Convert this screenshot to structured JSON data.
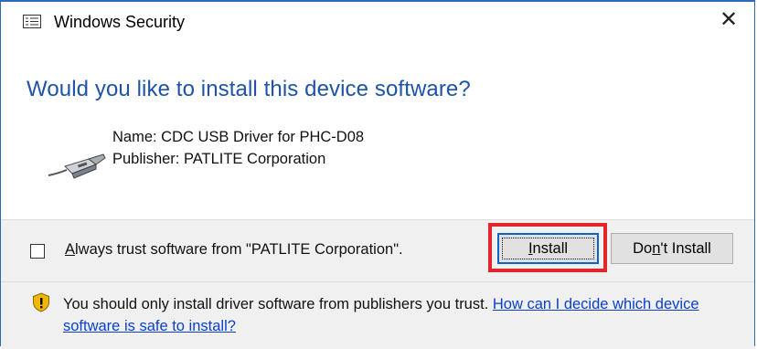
{
  "window": {
    "title": "Windows Security",
    "close_glyph": "✕"
  },
  "main": {
    "question": "Would you like to install this device software?",
    "device_name": "Name: CDC USB Driver for PHC-D08",
    "publisher": "Publisher: PATLITE Corporation"
  },
  "footer": {
    "trust_checkbox_checked": false,
    "trust_label_accel": "A",
    "trust_label_rest": "lways trust software from \"PATLITE Corporation\".",
    "install_accel": "I",
    "install_rest": "nstall",
    "dont_install_pre": "Do",
    "dont_install_accel": "n",
    "dont_install_post": "'t Install"
  },
  "warning": {
    "text": "You should only install driver software from publishers you trust. ",
    "link": "How can I decide which device software is safe to install?"
  },
  "icons": {
    "title": "security-list-icon",
    "device": "usb-cable-icon",
    "warning": "shield-warning-icon"
  },
  "colors": {
    "accent": "#1e53a8",
    "link": "#0a3fd0",
    "highlight": "#e3242b",
    "shield": "#f2b705"
  }
}
